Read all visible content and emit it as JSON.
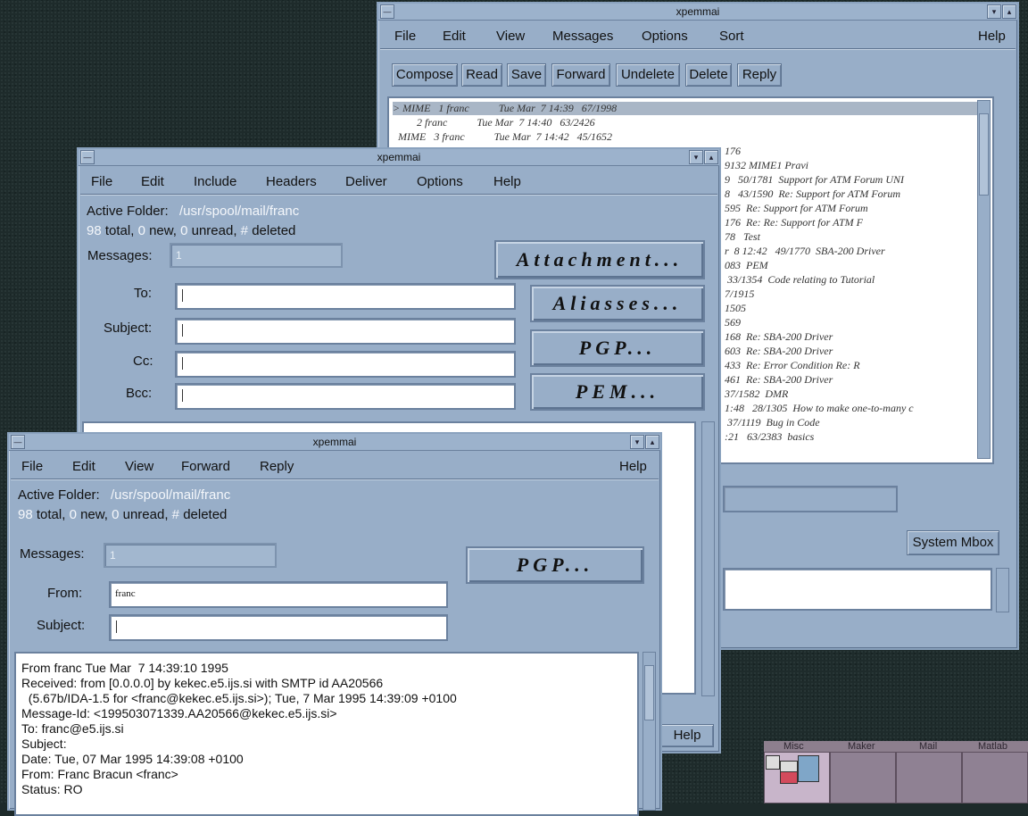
{
  "window_back": {
    "title": "xpemmai",
    "menu": [
      "File",
      "Edit",
      "View",
      "Messages",
      "Options",
      "Sort"
    ],
    "help": "Help",
    "toolbar": [
      "Compose",
      "Read",
      "Save",
      "Forward",
      "Undelete",
      "Delete",
      "Reply"
    ],
    "messages": [
      "> MIME   1 franc           Tue Mar  7 14:39   67/1998",
      "         2 franc           Tue Mar  7 14:40   63/2426",
      "  MIME   3 franc           Tue Mar  7 14:42   45/1652"
    ],
    "hidden_lines": [
      "176",
      "9132 MIME1 Pravi",
      "9   50/1781  Support for ATM Forum UNI",
      "8   43/1590  Re: Support for ATM Forum",
      "595  Re: Support for ATM Forum",
      "176  Re: Re: Support for ATM F",
      "78   Test",
      "r  8 12:42   49/1770  SBA-200 Driver",
      "083  PEM",
      " 33/1354  Code relating to Tutorial",
      "7/1915",
      "1505",
      "569",
      "168  Re: SBA-200 Driver",
      "603  Re: SBA-200 Driver",
      "433  Re: Error Condition Re: R",
      "461  Re: SBA-200 Driver",
      "37/1582  DMR",
      "1:48   28/1305  How to make one-to-many c",
      " 37/1119  Bug in Code",
      ":21   63/2383  basics"
    ],
    "system_mbox": "System Mbox"
  },
  "window_compose": {
    "title": "xpemmai",
    "menu": [
      "File",
      "Edit",
      "Include",
      "Headers",
      "Deliver",
      "Options",
      "Help"
    ],
    "active_folder_label": "Active Folder:",
    "active_folder": "/usr/spool/mail/franc",
    "stats": {
      "total": "98",
      "total_label": "total,",
      "new": "0",
      "new_label": "new,",
      "unread": "0",
      "unread_label": "unread,",
      "deleted": "#",
      "deleted_label": "deleted"
    },
    "messages_label": "Messages:",
    "messages_value": "1",
    "to_label": "To:",
    "subject_label": "Subject:",
    "cc_label": "Cc:",
    "bcc_label": "Bcc:",
    "attachment": "Attachment...",
    "aliasses": "Aliasses...",
    "pgp": "PGP...",
    "pem": "PEM...",
    "help": "Help"
  },
  "window_read": {
    "title": "xpemmai",
    "menu": [
      "File",
      "Edit",
      "View",
      "Forward",
      "Reply"
    ],
    "help": "Help",
    "active_folder_label": "Active Folder:",
    "active_folder": "/usr/spool/mail/franc",
    "stats": {
      "total": "98",
      "total_label": "total,",
      "new": "0",
      "new_label": "new,",
      "unread": "0",
      "unread_label": "unread,",
      "deleted": "#",
      "deleted_label": "deleted"
    },
    "messages_label": "Messages:",
    "messages_value": "1",
    "from_label": "From:",
    "from_value": "franc",
    "subject_label": "Subject:",
    "pgp": "PGP...",
    "body": [
      "From franc Tue Mar  7 14:39:10 1995",
      "Received: from [0.0.0.0] by kekec.e5.ijs.si with SMTP id AA20566",
      "  (5.67b/IDA-1.5 for <franc@kekec.e5.ijs.si>); Tue, 7 Mar 1995 14:39:09 +0100",
      "Message-Id: <199503071339.AA20566@kekec.e5.ijs.si>",
      "To: franc@e5.ijs.si",
      "Subject:",
      "Date: Tue, 07 Mar 1995 14:39:08 +0100",
      "From: Franc Bracun <franc>",
      "Status: RO"
    ]
  },
  "pager": {
    "desks": [
      "Misc",
      "Maker",
      "Mail",
      "Matlab"
    ]
  }
}
